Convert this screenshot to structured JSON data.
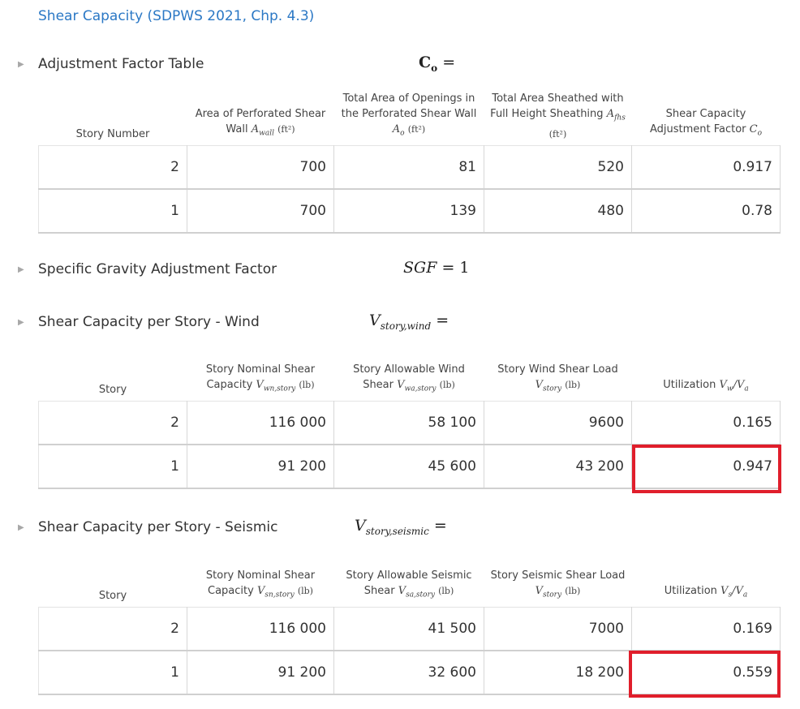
{
  "page": {
    "title": "Shear Capacity (SDPWS 2021, Chp. 4.3)"
  },
  "sections": {
    "adjustment": {
      "label": "Adjustment Factor Table",
      "symbol": "C",
      "symbol_sub": "o",
      "equals": "=",
      "headers": {
        "story": "Story Number",
        "area_wall_text": "Area of Perforated Shear Wall",
        "area_wall_sym": "A",
        "area_wall_sub": "wall",
        "area_open_text": "Total Area of Openings in the Perforated Shear Wall",
        "area_open_sym": "A",
        "area_open_sub": "o",
        "area_fhs_text": "Total Area Sheathed with Full Height Sheathing",
        "area_fhs_sym": "A",
        "area_fhs_sub": "fhs",
        "unit_ft2": "(ft²)",
        "co_text": "Shear Capacity Adjustment Factor",
        "co_sym": "C",
        "co_sub": "o"
      },
      "rows": [
        {
          "story": "2",
          "area_wall": "700",
          "area_open": "81",
          "area_fhs": "520",
          "co": "0.917"
        },
        {
          "story": "1",
          "area_wall": "700",
          "area_open": "139",
          "area_fhs": "480",
          "co": "0.78"
        }
      ]
    },
    "sgf": {
      "label": "Specific Gravity Adjustment Factor",
      "symbol": "SGF",
      "equals": "=",
      "value": "1"
    },
    "wind": {
      "label": "Shear Capacity per Story - Wind",
      "symbol": "V",
      "symbol_sub": "story,wind",
      "equals": "=",
      "headers": {
        "story": "Story",
        "nominal_text": "Story Nominal Shear Capacity",
        "nominal_sym": "V",
        "nominal_sub": "wn,story",
        "allow_text": "Story Allowable Wind Shear",
        "allow_sym": "V",
        "allow_sub": "wa,story",
        "load_text": "Story Wind Shear Load",
        "load_sym": "V",
        "load_sub": "story",
        "unit_lb": "(lb)",
        "util_text": "Utilization",
        "util_sym": "V",
        "util_sub": "w",
        "util_slash": "/",
        "util_sym2": "V",
        "util_sub2": "a"
      },
      "rows": [
        {
          "story": "2",
          "nominal": "116 000",
          "allow": "58 100",
          "load": "9600",
          "util": "0.165"
        },
        {
          "story": "1",
          "nominal": "91 200",
          "allow": "45 600",
          "load": "43 200",
          "util": "0.947"
        }
      ]
    },
    "seismic": {
      "label": "Shear Capacity per Story - Seismic",
      "symbol": "V",
      "symbol_sub": "story,seismic",
      "equals": "=",
      "headers": {
        "story": "Story",
        "nominal_text": "Story Nominal Shear Capacity",
        "nominal_sym": "V",
        "nominal_sub": "sn,story",
        "allow_text": "Story Allowable Seismic Shear",
        "allow_sym": "V",
        "allow_sub": "sa,story",
        "load_text": "Story Seismic Shear Load",
        "load_sym": "V",
        "load_sub": "story",
        "unit_lb": "(lb)",
        "util_text": "Utilization",
        "util_sym": "V",
        "util_sub": "s",
        "util_slash": "/",
        "util_sym2": "V",
        "util_sub2": "a"
      },
      "rows": [
        {
          "story": "2",
          "nominal": "116 000",
          "allow": "41 500",
          "load": "7000",
          "util": "0.169"
        },
        {
          "story": "1",
          "nominal": "91 200",
          "allow": "32 600",
          "load": "18 200",
          "util": "0.559"
        }
      ]
    }
  },
  "colors": {
    "title": "#2b78c5",
    "highlight": "#e01e2b"
  }
}
